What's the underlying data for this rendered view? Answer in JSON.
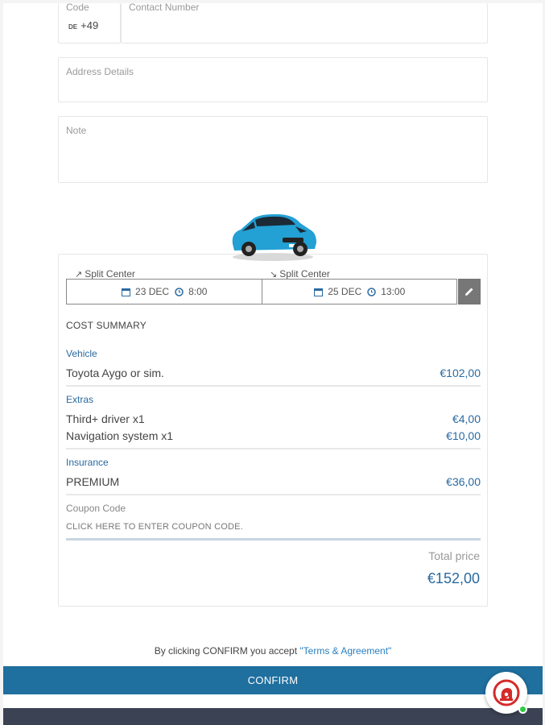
{
  "form": {
    "code_label": "Code",
    "code_flag": "DE",
    "code_value": "+49",
    "contact_label": "Contact Number",
    "address_label": "Address Details",
    "note_label": "Note"
  },
  "rental": {
    "pickup_location": "Split Center",
    "pickup_date": "23 DEC",
    "pickup_time": "8:00",
    "dropoff_location": "Split Center",
    "dropoff_date": "25 DEC",
    "dropoff_time": "13:00"
  },
  "summary": {
    "title": "COST SUMMARY",
    "vehicle_label": "Vehicle",
    "vehicle_name": "Toyota Aygo or sim.",
    "vehicle_price": "€102,00",
    "extras_label": "Extras",
    "extras": [
      {
        "name": "Third+ driver x1",
        "price": "€4,00"
      },
      {
        "name": "Navigation system x1",
        "price": "€10,00"
      }
    ],
    "insurance_label": "Insurance",
    "insurance_name": "PREMIUM",
    "insurance_price": "€36,00",
    "coupon_label": "Coupon Code",
    "coupon_link": "CLICK HERE TO ENTER COUPON CODE.",
    "total_label": "Total price",
    "total_value": "€152,00"
  },
  "footer": {
    "terms_text": "By clicking CONFIRM you accept ",
    "terms_link": "\"Terms & Agreement\"",
    "confirm_label": "CONFIRM"
  },
  "colors": {
    "accent": "#1f6f9f",
    "price": "#2a6aa0",
    "footer_bar": "#3b4253",
    "online": "#2ecc40"
  },
  "icons": [
    "calendar-icon",
    "clock-icon",
    "pencil-icon",
    "pickup-arrow-icon",
    "dropoff-arrow-icon",
    "chat-logo-icon"
  ]
}
